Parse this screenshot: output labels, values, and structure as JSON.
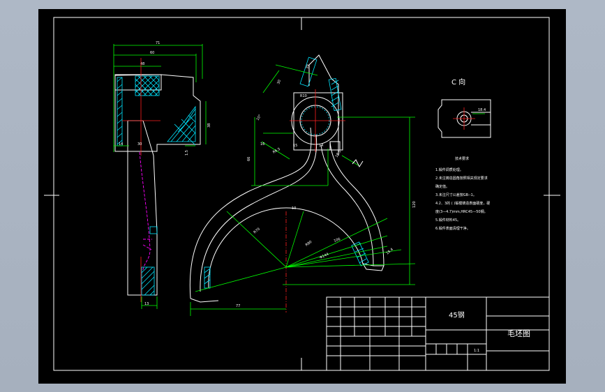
{
  "drawing": {
    "view_label": "C 向",
    "title_material": "45钢",
    "title_name": "毛坯图",
    "title_scale": "1:1",
    "tech_title": "技术要求",
    "tech_notes": [
      "1.锻件调质处理。",
      "2.未注铸造圆角按照相关规定要求",
      "  确定值。",
      "3.未注尺寸公差按GB--1。",
      "4.2、3的 ( )锻模铸造表面硬度，硬",
      "  度(3—4.7)mm,HRC45—50钢。",
      "5.锻件材料45。",
      "6.锻件表面清理干净。"
    ],
    "dims": {
      "top_overall": "71",
      "top_inner": "60",
      "inner_width": "48",
      "left_a": "14",
      "left_b": "30",
      "side_h": "1.5",
      "right_h": "38",
      "bottom_w": "13",
      "radius_main": "R70",
      "radius_inner": "R80",
      "angle_a": "Φ144",
      "dim_77": "77",
      "dim_120": "120",
      "dim_14": "14",
      "dim_15": "15",
      "dim_10": "10",
      "r_small": "R6.5",
      "r_boss": "R10",
      "dim_30": "30",
      "dim_39": "39",
      "dim_h16": "16",
      "dim_66": "66",
      "dim_vr": "106",
      "dim_18": "18.5",
      "deg": "10°",
      "c_dim": "18.4"
    }
  }
}
